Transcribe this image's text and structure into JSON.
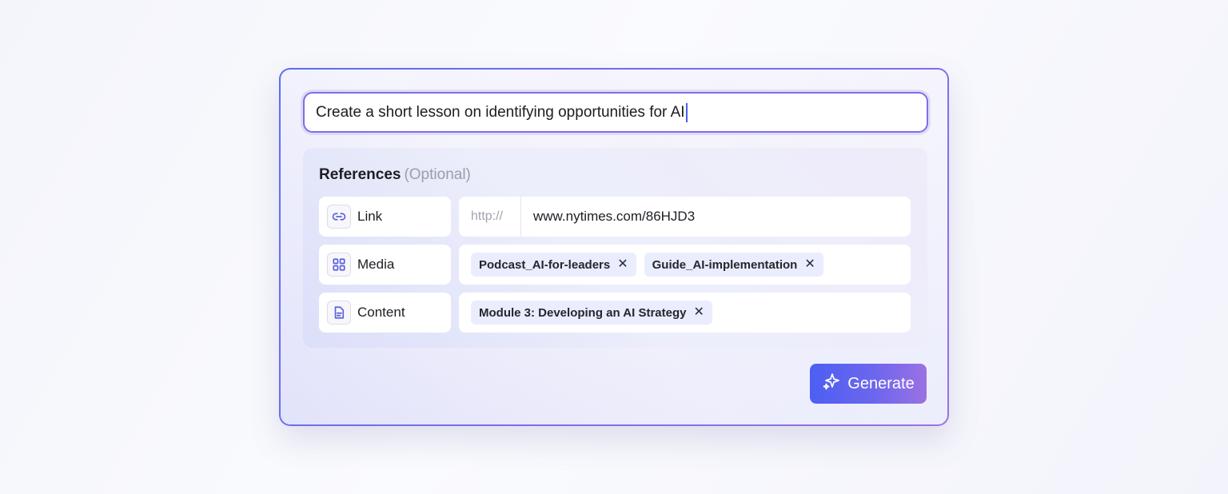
{
  "prompt": {
    "value": "Create a short lesson on identifying opportunities for AI"
  },
  "references": {
    "title": "References",
    "optional": "(Optional)",
    "link": {
      "label": "Link",
      "prefix": "http://",
      "value": "www.nytimes.com/86HJD3",
      "icon": "link-icon"
    },
    "media": {
      "label": "Media",
      "icon": "grid-icon",
      "chips": [
        "Podcast_AI-for-leaders",
        "Guide_AI-implementation"
      ]
    },
    "content": {
      "label": "Content",
      "icon": "document-icon",
      "chips": [
        "Module 3: Developing an AI Strategy"
      ]
    }
  },
  "generate": {
    "label": "Generate",
    "icon": "sparkle-icon"
  },
  "colors": {
    "accent": "#5b6df0",
    "accent_end": "#9b71e2",
    "chip_bg": "#eaedfd"
  }
}
